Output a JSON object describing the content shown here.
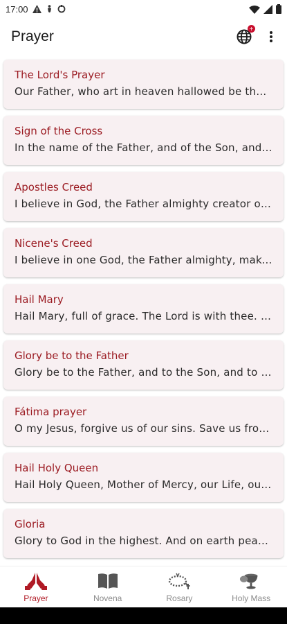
{
  "status": {
    "time": "17:00"
  },
  "appbar": {
    "title": "Prayer",
    "badge": "+"
  },
  "prayers": [
    {
      "title": "The Lord's Prayer",
      "text": "Our Father, who art in heaven hallowed be thy name; thy kingdom come"
    },
    {
      "title": "Sign of the Cross",
      "text": "In the name of the Father, and of the Son, and of the Holy Spirit."
    },
    {
      "title": "Apostles Creed",
      "text": "I believe in God, the Father almighty creator of heaven and earth"
    },
    {
      "title": "Nicene's Creed",
      "text": "I believe in one God, the Father almighty, maker of heaven and earth"
    },
    {
      "title": "Hail Mary",
      "text": "Hail Mary, full of grace. The Lord is with thee. Blessed art thou"
    },
    {
      "title": "Glory be to the Father",
      "text": "Glory be to the Father, and to the Son, and to the Holy Spirit"
    },
    {
      "title": "Fátima prayer",
      "text": "O my Jesus, forgive us of our sins. Save us from the fires of hell"
    },
    {
      "title": "Hail Holy Queen",
      "text": "Hail Holy Queen, Mother of Mercy, our Life, our sweetness"
    },
    {
      "title": "Gloria",
      "text": "Glory to God in the highest. And on earth peace to people of good will"
    }
  ],
  "nav": [
    {
      "label": "Prayer",
      "icon": "praying-hands-icon",
      "active": true
    },
    {
      "label": "Novena",
      "icon": "book-icon",
      "active": false
    },
    {
      "label": "Rosary",
      "icon": "rosary-icon",
      "active": false
    },
    {
      "label": "Holy Mass",
      "icon": "chalice-icon",
      "active": false
    }
  ],
  "colors": {
    "accent": "#9b1b22",
    "card_bg": "#f8f0f2",
    "nav_active": "#b01a25",
    "nav_inactive": "#8a8a8a"
  }
}
